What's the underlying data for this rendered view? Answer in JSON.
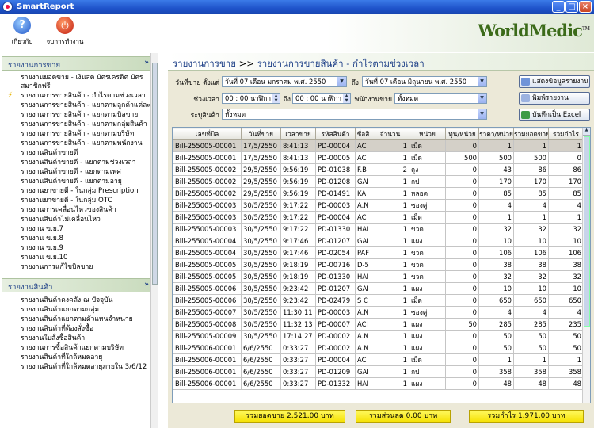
{
  "window": {
    "title": "SmartReport"
  },
  "toolbar": {
    "help_label": "เกี่ยวกับ",
    "exit_label": "จบการทำงาน",
    "logo": "WorldMedic",
    "logo_tm": "TM"
  },
  "sidebar": {
    "section1": {
      "title": "รายงานการขาย",
      "items": [
        "รายงานยอดขาย - เงินสด บัตรเครดิต บัตรสมาชิกฟรี",
        "รายงานการขายสินค้า - กำไรตามช่วงเวลา",
        "รายงานการขายสินค้า - แยกตามลูกค้าแต่ละราย",
        "รายงานการขายสินค้า - แยกตามบิลขาย",
        "รายงานการขายสินค้า - แยกตามกลุ่มสินค้า",
        "รายงานการขายสินค้า - แยกตามบริษัท",
        "รายงานการขายสินค้า - แยกตามพนักงาน",
        "รายงานสินค้าขายดี",
        "รายงานสินค้าขายดี - แยกตามช่วงเวลา",
        "รายงานสินค้าขายดี - แยกตามเพศ",
        "รายงานสินค้าขายดี - แยกตามอายุ",
        "รายงานยาขายดี - ในกลุ่ม Prescription",
        "รายงานยาขายดี - ในกลุ่ม OTC",
        "รายงานการเคลื่อนไหวของสินค้า",
        "รายงานสินค้าไม่เคลื่อนไหว",
        "รายงาน ข.ย.7",
        "รายงาน ข.ย.8",
        "รายงาน ข.ย.9",
        "รายงาน ข.ย.10",
        "รายงานการแก้ไขบิลขาย"
      ]
    },
    "section2": {
      "title": "รายงานสินค้า",
      "items": [
        "รายงานสินค้าคงคลัง ณ ปัจจุบัน",
        "รายงานสินค้าแยกตามกลุ่ม",
        "รายงานสินค้าแยกตามตัวแทนจำหน่าย",
        "รายงานสินค้าที่ต้องสั่งซื้อ",
        "รายงานใบสั่งซื้อสินค้า",
        "รายงานการซื้อสินค้าแยกตามบริษัท",
        "รายงานสินค้าที่ใกล้หมดอายุ",
        "รายงานสินค้าที่ใกล้หมดอายุภายใน 3/6/12"
      ]
    }
  },
  "page": {
    "title_prefix": "รายงานการขาย",
    "arrow": ">>",
    "title": "รายงานการขายสินค้า - กำไรตามช่วงเวลา"
  },
  "filters": {
    "date_label": "วันที่ขาย ตั้งแต่",
    "date_from": "วันที่ 07 เดือน มกราคม พ.ศ. 2550",
    "to_label": "ถึง",
    "date_to": "วันที่ 07 เดือน มิถุนายน พ.ศ. 2550",
    "time_label": "ช่วงเวลา",
    "time_from": "00 : 00 นาฬิกา",
    "time_to": "00 : 00 นาฬิกา",
    "staff_label": "พนักงานขาย",
    "staff_value": "ทั้งหมด",
    "product_label": "ระบุสินค้า",
    "product_value": "ทั้งหมด"
  },
  "actions": {
    "show": "แสดงข้อมูลรายงาน",
    "print": "พิมพ์รายงาน",
    "excel": "บันทึกเป็น Excel"
  },
  "table": {
    "headers": [
      "เลขที่บิล",
      "วันที่ขาย",
      "เวลาขาย",
      "รหัสสินค้า",
      "ชื่อสิ",
      "จำนวน",
      "หน่วย",
      "ทุน/หน่วย",
      "ราคา/หน่วย",
      "รวมยอดขาย",
      "รวมกำไร"
    ],
    "rows": [
      [
        "Bill-255005-00001",
        "17/5/2550",
        "8:41:13",
        "PD-00004",
        "AC",
        "1",
        "เม็ด",
        "0",
        "1",
        "1",
        "1"
      ],
      [
        "Bill-255005-00001",
        "17/5/2550",
        "8:41:13",
        "PD-00005",
        "AC",
        "1",
        "เม็ด",
        "500",
        "500",
        "500",
        "0"
      ],
      [
        "Bill-255005-00002",
        "29/5/2550",
        "9:56:19",
        "PD-01038",
        "F.B",
        "2",
        "ถุง",
        "0",
        "43",
        "86",
        "86"
      ],
      [
        "Bill-255005-00002",
        "29/5/2550",
        "9:56:19",
        "PD-01208",
        "GAI",
        "1",
        "กป",
        "0",
        "170",
        "170",
        "170"
      ],
      [
        "Bill-255005-00002",
        "29/5/2550",
        "9:56:19",
        "PD-01491",
        "KA",
        "1",
        "หลอด",
        "0",
        "85",
        "85",
        "85"
      ],
      [
        "Bill-255005-00003",
        "30/5/2550",
        "9:17:22",
        "PD-00003",
        "A.N",
        "1",
        "ซองคู่",
        "0",
        "4",
        "4",
        "4"
      ],
      [
        "Bill-255005-00003",
        "30/5/2550",
        "9:17:22",
        "PD-00004",
        "AC",
        "1",
        "เม็ด",
        "0",
        "1",
        "1",
        "1"
      ],
      [
        "Bill-255005-00003",
        "30/5/2550",
        "9:17:22",
        "PD-01330",
        "HAI",
        "1",
        "ขวด",
        "0",
        "32",
        "32",
        "32"
      ],
      [
        "Bill-255005-00004",
        "30/5/2550",
        "9:17:46",
        "PD-01207",
        "GAI",
        "1",
        "แผง",
        "0",
        "10",
        "10",
        "10"
      ],
      [
        "Bill-255005-00004",
        "30/5/2550",
        "9:17:46",
        "PD-02054",
        "PAF",
        "1",
        "ขวด",
        "0",
        "106",
        "106",
        "106"
      ],
      [
        "Bill-255005-00005",
        "30/5/2550",
        "9:18:19",
        "PD-00716",
        "D-5",
        "1",
        "ขวด",
        "0",
        "38",
        "38",
        "38"
      ],
      [
        "Bill-255005-00005",
        "30/5/2550",
        "9:18:19",
        "PD-01330",
        "HAI",
        "1",
        "ขวด",
        "0",
        "32",
        "32",
        "32"
      ],
      [
        "Bill-255005-00006",
        "30/5/2550",
        "9:23:42",
        "PD-01207",
        "GAI",
        "1",
        "แผง",
        "0",
        "10",
        "10",
        "10"
      ],
      [
        "Bill-255005-00006",
        "30/5/2550",
        "9:23:42",
        "PD-02479",
        "S C",
        "1",
        "เม็ด",
        "0",
        "650",
        "650",
        "650"
      ],
      [
        "Bill-255005-00007",
        "30/5/2550",
        "11:30:11",
        "PD-00003",
        "A.N",
        "1",
        "ซองคู่",
        "0",
        "4",
        "4",
        "4"
      ],
      [
        "Bill-255005-00008",
        "30/5/2550",
        "11:32:13",
        "PD-00007",
        "ACI",
        "1",
        "แผง",
        "50",
        "285",
        "285",
        "235"
      ],
      [
        "Bill-255005-00009",
        "30/5/2550",
        "17:14:27",
        "PD-00002",
        "A.N",
        "1",
        "แผง",
        "0",
        "50",
        "50",
        "50"
      ],
      [
        "Bill-255006-00001",
        "6/6/2550",
        "0:33:27",
        "PD-00002",
        "A.N",
        "1",
        "แผง",
        "0",
        "50",
        "50",
        "50"
      ],
      [
        "Bill-255006-00001",
        "6/6/2550",
        "0:33:27",
        "PD-00004",
        "AC",
        "1",
        "เม็ด",
        "0",
        "1",
        "1",
        "1"
      ],
      [
        "Bill-255006-00001",
        "6/6/2550",
        "0:33:27",
        "PD-01209",
        "GAI",
        "1",
        "กป",
        "0",
        "358",
        "358",
        "358"
      ],
      [
        "Bill-255006-00001",
        "6/6/2550",
        "0:33:27",
        "PD-01332",
        "HAI",
        "1",
        "แผง",
        "0",
        "48",
        "48",
        "48"
      ]
    ]
  },
  "totals": {
    "sales": "รวมยอดขาย 2,521.00 บาท",
    "discount": "รวมส่วนลด 0.00 บาท",
    "profit": "รวมกำไร 1,971.00 บาท"
  }
}
